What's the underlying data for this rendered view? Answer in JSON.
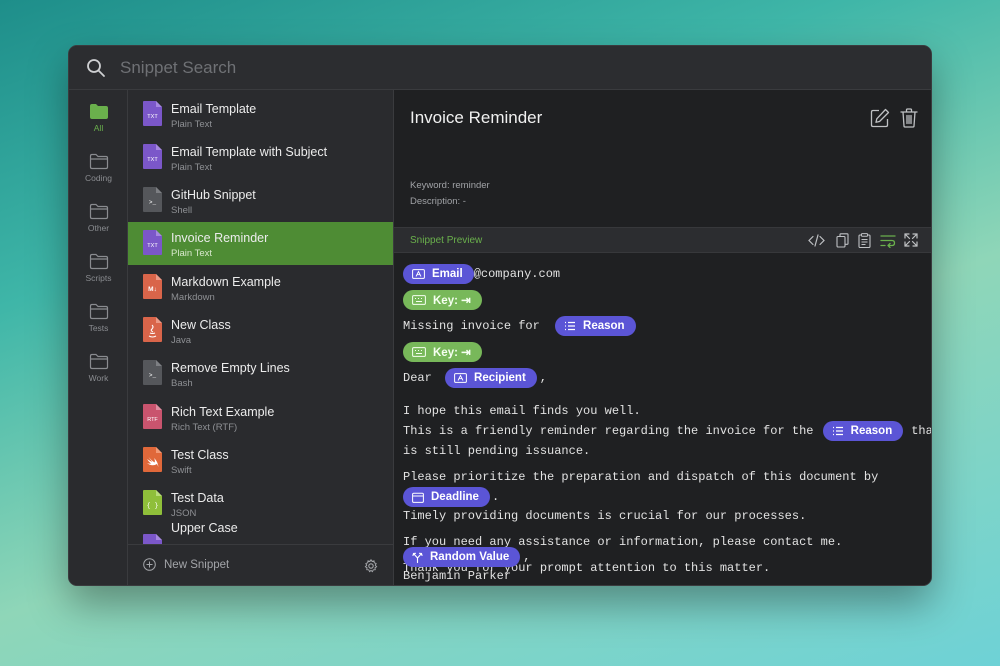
{
  "search": {
    "placeholder": "Snippet Search"
  },
  "rail": [
    {
      "label": "All"
    },
    {
      "label": "Coding"
    },
    {
      "label": "Other"
    },
    {
      "label": "Scripts"
    },
    {
      "label": "Tests"
    },
    {
      "label": "Work"
    }
  ],
  "snippets": [
    {
      "title": "Email Template",
      "type": "Plain Text",
      "badge": "TXT"
    },
    {
      "title": "Email Template with Subject",
      "type": "Plain Text",
      "badge": "TXT"
    },
    {
      "title": "GitHub Snippet",
      "type": "Shell",
      "badge": ">_"
    },
    {
      "title": "Invoice Reminder",
      "type": "Plain Text",
      "badge": "TXT"
    },
    {
      "title": "Markdown Example",
      "type": "Markdown",
      "badge": "M↓"
    },
    {
      "title": "New Class",
      "type": "Java",
      "badge": ""
    },
    {
      "title": "Remove Empty Lines",
      "type": "Bash",
      "badge": ">_"
    },
    {
      "title": "Rich Text Example",
      "type": "Rich Text (RTF)",
      "badge": "RTF"
    },
    {
      "title": "Test Class",
      "type": "Swift",
      "badge": ""
    },
    {
      "title": "Test Data",
      "type": "JSON",
      "badge": "{ }"
    },
    {
      "title": "Upper Case",
      "type": "",
      "badge": ""
    }
  ],
  "footer": {
    "new_snippet": "New Snippet"
  },
  "detail": {
    "title": "Invoice Reminder",
    "keyword": "Keyword: reminder",
    "description": "Description: -",
    "preview_label": "Snippet Preview"
  },
  "body": {
    "pill_email": "Email",
    "email_suffix": "@company.com",
    "pill_key": "Key: ⇥",
    "missing_invoice": "Missing invoice for ",
    "pill_reason": "Reason",
    "dear": "Dear ",
    "pill_recipient": "Recipient",
    "comma": ",",
    "l1": "I hope this email finds you well.",
    "l2": "This is a friendly reminder regarding the invoice for the ",
    "that": "that",
    "l3": "is still pending issuance.",
    "l4": "Please prioritize the preparation and dispatch of this document by",
    "pill_deadline": "Deadline",
    "period": ".",
    "l5": "Timely providing documents is crucial for our processes.",
    "l6": "If you need any assistance or information, please contact me.",
    "l7": "Thank you for your prompt attention to this matter.",
    "pill_random": "Random Value",
    "signature": "Benjamin Parker"
  },
  "colors": {
    "accent_green": "#4e8c34",
    "pill_purple": "#5b55d6",
    "pill_green": "#78b85a"
  }
}
